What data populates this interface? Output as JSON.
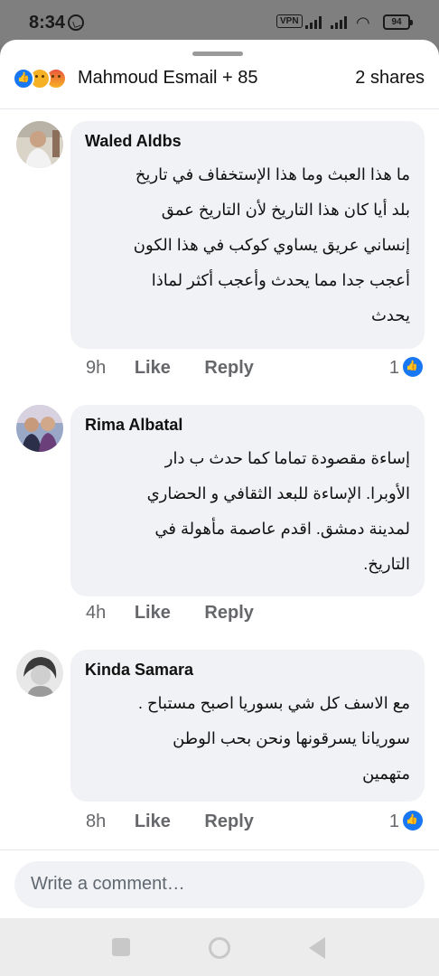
{
  "status_bar": {
    "time": "8:34",
    "vpn": "VPN",
    "battery": "94",
    "icons": [
      "whatsapp-icon",
      "signal-icon",
      "wifi-icon",
      "battery-icon"
    ]
  },
  "reactions_header": {
    "reaction_icons": [
      "like-icon",
      "sad-icon",
      "angry-icon"
    ],
    "reactors": "Mahmoud Esmail + 85",
    "shares": "2 shares"
  },
  "comments": [
    {
      "author": "Waled Aldbs",
      "lines": [
        "ما هذا العبث وما هذا الإستخفاف في تاريخ",
        "بلد أيا كان هذا التاريخ لأن التاريخ عمق",
        "إنساني عريق يساوي كوكب في هذا الكون",
        "أعجب جدا مما يحدث وأعجب أكثر لماذا",
        "يحدث"
      ],
      "time": "9h",
      "like": "Like",
      "reply": "Reply",
      "reaction_count": "1"
    },
    {
      "author": "Rima Albatal",
      "lines": [
        "إساءة مقصودة تماما كما حدث ب دار",
        "الأوبرا.   الإساءة للبعد الثقافي و الحضاري",
        "لمدينة دمشق. اقدم عاصمة مأهولة في",
        "التاريخ."
      ],
      "time": "4h",
      "like": "Like",
      "reply": "Reply",
      "reaction_count": ""
    },
    {
      "author": "Kinda Samara",
      "lines": [
        "مع الاسف كل شي بسوريا اصبح مستباح .",
        "سوريانا  يسرقونها ونحن بحب الوطن",
        "متهمين"
      ],
      "time": "8h",
      "like": "Like",
      "reply": "Reply",
      "reaction_count": "1"
    }
  ],
  "composer": {
    "placeholder": "Write a comment…"
  },
  "colors": {
    "like_blue": "#1877f2",
    "bubble": "#f0f2f5",
    "secondary_text": "#65676b"
  }
}
